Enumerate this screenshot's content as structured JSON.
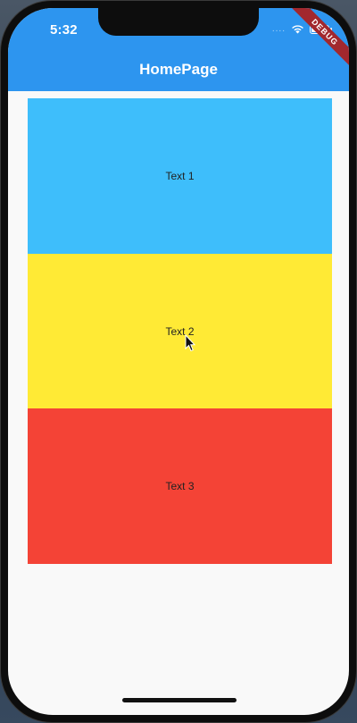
{
  "status_bar": {
    "time": "5:32",
    "signal": "....",
    "wifi_icon": "wifi-icon",
    "battery_icon": "battery-icon"
  },
  "debug_banner": {
    "label": "DEBUG"
  },
  "app_bar": {
    "title": "HomePage",
    "color": "#2d95ef"
  },
  "panels": [
    {
      "label": "Text 1",
      "color": "#3ebefb"
    },
    {
      "label": "Text 2",
      "color": "#ffea35"
    },
    {
      "label": "Text 3",
      "color": "#f44336"
    }
  ],
  "icons": {
    "cursor": "mouse-pointer-icon"
  }
}
